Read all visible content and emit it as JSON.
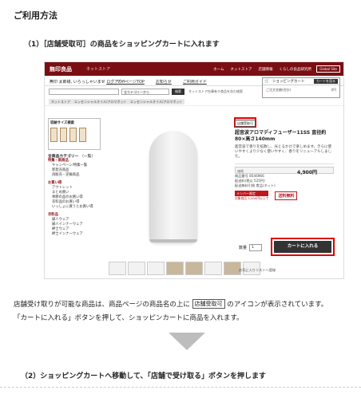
{
  "page_title": "ご利用方法",
  "step1": "（1）［店舗受取可］の商品をショッピングカートに入れます",
  "step2": "（2）ショッピングカートへ移動して、「店舗で受け取る」ボタンを押します",
  "desc": {
    "line1_before": "店舗受け取りが可能な商品は、商品ページの商品名の上に",
    "line1_badge": "店舗受取可",
    "line1_after": "のアイコンが表示されています。",
    "line2": "「カートに入れる」ボタンを押して、ショッピンカートに商品を入れます。"
  },
  "shot": {
    "logo": "無印良品",
    "store": "ネットストア",
    "topnav": [
      "ホーム",
      "ネットストア",
      "店舗情報",
      "くらしの良品研究所"
    ],
    "global": "Global Site",
    "greeting": "無印 太郎様, いらっしゃいませ",
    "logout": "ログアウト",
    "mylinks": [
      "マイページTOP",
      "お知らせ",
      "ご利用ガイド"
    ],
    "cart_title": "ショッピングカート",
    "cart_btn": "カートを見る",
    "cart_left": "ご注文金額(合計)",
    "cart_right": "0円",
    "search_select": "全カテゴリーから",
    "search_btn": "検索",
    "search_option": "ネットストア在庫有り商品を含む検索",
    "crumbs": [
      "ネットストア",
      "エッセンシャルオイル/アロマポット",
      "エッセンシャルオイル/アロマポット"
    ],
    "side_title": "収納サイズ検索",
    "side_cat": "全商品カテゴリー",
    "side_cat_sub": "（一覧）",
    "side_s1": "特集・新商品",
    "side_s1_links": [
      "キャンペーン/特集一覧",
      "新発売商品",
      "再販売・逆輸商品"
    ],
    "side_s2": "お買い得",
    "side_s2_links": [
      "アウトレット",
      "まとめ買い",
      "季節の品のお買い得",
      "衣料品のお買い得",
      "いっしょに買うとお買い得"
    ],
    "side_s3": "衣料品",
    "side_s3_links": [
      "婦人ウェア",
      "婦人インナーウェア",
      "紳士ウェア",
      "紳士インナーウェア"
    ],
    "store_badge": "店舗受取可",
    "product_name": "超音波アロマディフューザー11SS 直径約80×高さ140mm",
    "product_desc": "超音波で香りを拡散し、光とるかけで楽しめます。きらに使いやすくより少なく使いやすく、香りをリニューアルしました。",
    "price_label": "価格",
    "price": "4,900円",
    "spec_lines": [
      "商品番号 8546966",
      "配送料(税込 525円)",
      "配送無料引換 食品(ネット)"
    ],
    "member_badge": "メンバー限定",
    "member_sub": "対象商品 5,000円以上で",
    "free_ship": "送料無料",
    "qty_label": "数量",
    "qty_value": "1",
    "add_cart": "カートに入れる",
    "favorite": "お気に入りリストへ登録"
  }
}
